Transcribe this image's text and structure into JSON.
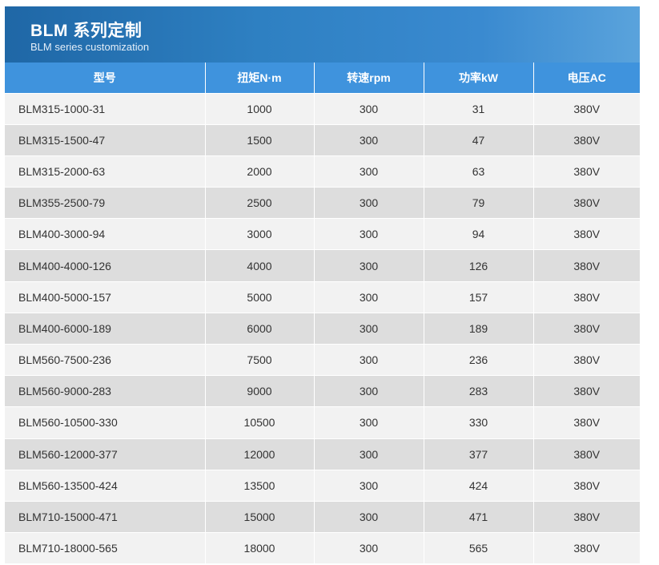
{
  "header": {
    "title": "BLM 系列定制",
    "subtitle": "BLM series customization"
  },
  "table": {
    "columns": [
      "型号",
      "扭矩N·m",
      "转速rpm",
      "功率kW",
      "电压AC"
    ],
    "rows": [
      [
        "BLM315-1000-31",
        "1000",
        "300",
        "31",
        "380V"
      ],
      [
        "BLM315-1500-47",
        "1500",
        "300",
        "47",
        "380V"
      ],
      [
        "BLM315-2000-63",
        "2000",
        "300",
        "63",
        "380V"
      ],
      [
        "BLM355-2500-79",
        "2500",
        "300",
        "79",
        "380V"
      ],
      [
        "BLM400-3000-94",
        "3000",
        "300",
        "94",
        "380V"
      ],
      [
        "BLM400-4000-126",
        "4000",
        "300",
        "126",
        "380V"
      ],
      [
        "BLM400-5000-157",
        "5000",
        "300",
        "157",
        "380V"
      ],
      [
        "BLM400-6000-189",
        "6000",
        "300",
        "189",
        "380V"
      ],
      [
        "BLM560-7500-236",
        "7500",
        "300",
        "236",
        "380V"
      ],
      [
        "BLM560-9000-283",
        "9000",
        "300",
        "283",
        "380V"
      ],
      [
        "BLM560-10500-330",
        "10500",
        "300",
        "330",
        "380V"
      ],
      [
        "BLM560-12000-377",
        "12000",
        "300",
        "377",
        "380V"
      ],
      [
        "BLM560-13500-424",
        "13500",
        "300",
        "424",
        "380V"
      ],
      [
        "BLM710-15000-471",
        "15000",
        "300",
        "471",
        "380V"
      ],
      [
        "BLM710-18000-565",
        "18000",
        "300",
        "565",
        "380V"
      ]
    ]
  }
}
